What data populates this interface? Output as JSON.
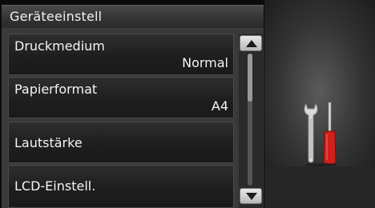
{
  "header": {
    "title": "Geräteeinstell"
  },
  "menu": {
    "items": [
      {
        "label": "Druckmedium",
        "value": "Normal"
      },
      {
        "label": "Papierformat",
        "value": "A4"
      },
      {
        "label": "Lautstärke",
        "value": ""
      },
      {
        "label": "LCD-Einstell.",
        "value": ""
      }
    ]
  },
  "scroll": {
    "position": 0.0
  },
  "icons": {
    "illustration": "wrench-screwdriver-icon",
    "up": "chevron-up-icon",
    "down": "chevron-down-icon"
  },
  "colors": {
    "accent_red": "#d0201c",
    "background": "#0b0b0b",
    "button_bg": "#1e1e1e"
  }
}
